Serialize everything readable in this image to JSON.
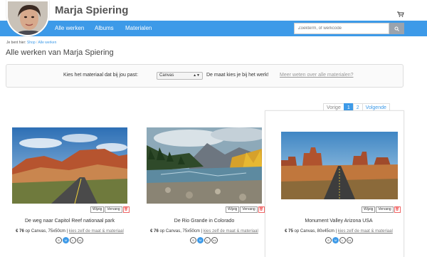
{
  "header": {
    "site_title": "Marja Spiering",
    "cart_icon": "cart-icon"
  },
  "nav": {
    "items": [
      "Alle werken",
      "Albums",
      "Materialen"
    ],
    "search_placeholder": "Zoekterm, of werkcode",
    "search_icon": "search-icon"
  },
  "breadcrumb": {
    "prefix": "Je bent hier:",
    "shop": "Shop",
    "separator": "/",
    "current": "Alle werken"
  },
  "page_title": "Alle werken van Marja Spiering",
  "filter": {
    "label": "Kies het materiaal dat bij jou past:",
    "selected": "Canvas",
    "tagline": "De maat kies je bij het werk!",
    "link": "Meer weten over alle materialen?"
  },
  "pager": {
    "prev": "Vorige",
    "pages": [
      "1",
      "2"
    ],
    "active": "1",
    "next": "Volgende"
  },
  "colors": {
    "accent": "#3d9ae8",
    "delete": "#e33333"
  },
  "works": [
    {
      "title": "De weg naar Capitol Reef nationaal park",
      "price": "€ 76",
      "spec": "op Canvas, 75x50cm |",
      "link": "kies zelf de maat & materiaal",
      "edit": "Wijzig",
      "replace": "Vervang",
      "sizes": [
        "S",
        "M",
        "L",
        "XL"
      ],
      "selected_size": "M"
    },
    {
      "title": "De Rio Grande in Colorado",
      "price": "€ 76",
      "spec": "op Canvas, 75x50cm |",
      "link": "kies zelf de maat & materiaal",
      "edit": "Wijzig",
      "replace": "Vervang",
      "sizes": [
        "S",
        "M",
        "L",
        "XL"
      ],
      "selected_size": "M"
    },
    {
      "title": "Monument Valley Arizona USA",
      "price": "€ 75",
      "spec": "op Canvas, 80x45cm |",
      "link": "kies zelf de maat & materiaal",
      "edit": "Wijzig",
      "replace": "Vervang",
      "sizes": [
        "S",
        "M",
        "L",
        "XL"
      ],
      "selected_size": "M"
    }
  ]
}
